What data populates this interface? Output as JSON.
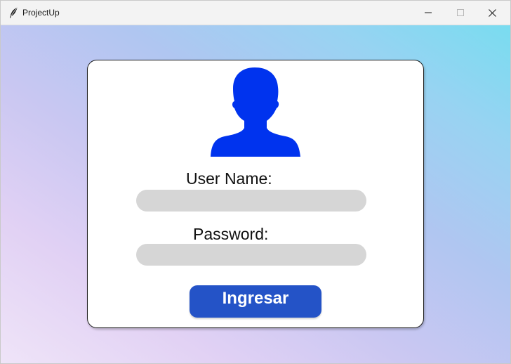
{
  "window": {
    "title": "ProjectUp",
    "icon": "feather-icon",
    "controls": {
      "minimize": "minimize-icon",
      "maximize": "maximize-icon",
      "close": "close-icon"
    }
  },
  "login": {
    "avatar_icon": "user-avatar-icon",
    "username_label": "User Name:",
    "username_value": "",
    "password_label": "Password:",
    "password_value": "",
    "submit_label": "Ingresar"
  },
  "colors": {
    "avatar": "#0033ee",
    "button": "#2453c7",
    "field": "#d6d6d6"
  }
}
